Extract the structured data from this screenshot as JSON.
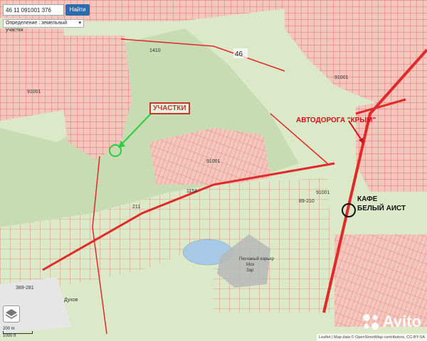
{
  "search": {
    "value": "46 11 091001 376",
    "button_label": "Найти"
  },
  "layer_select": {
    "value": "Определение : земельный участок"
  },
  "labels": {
    "plots": "УЧАСТКИ",
    "highway": "АВТОДОРОГА \"КРЫМ\"",
    "cafe_line1": "КАФЕ",
    "cafe_line2": "БЕЛЫЙ АИСТ",
    "block_46": "46",
    "quarry": "Песчаный карьер",
    "quarry_sub": "Мох",
    "quarry_sub2": "Зар",
    "village": "Духов"
  },
  "parcel_numbers": {
    "n1": "91001",
    "n2": "91001",
    "n3": "91001",
    "n4": "91001",
    "n5": "89-210",
    "n6": "389-281",
    "n7": "1154",
    "n8": "1410",
    "n9": "211"
  },
  "scale": {
    "top": "200 m",
    "bottom": "1000 ft"
  },
  "attribution": "Leaflet | Map data © OpenStreetMap contributors, CC-BY-SA",
  "watermark": "Avito",
  "colors": {
    "map_bg": "#dbe9c8",
    "parcel_fill": "#f3c7bd",
    "parcel_line": "#e05a52",
    "road": "#e02a2a",
    "forest": "#c8dcb4"
  }
}
